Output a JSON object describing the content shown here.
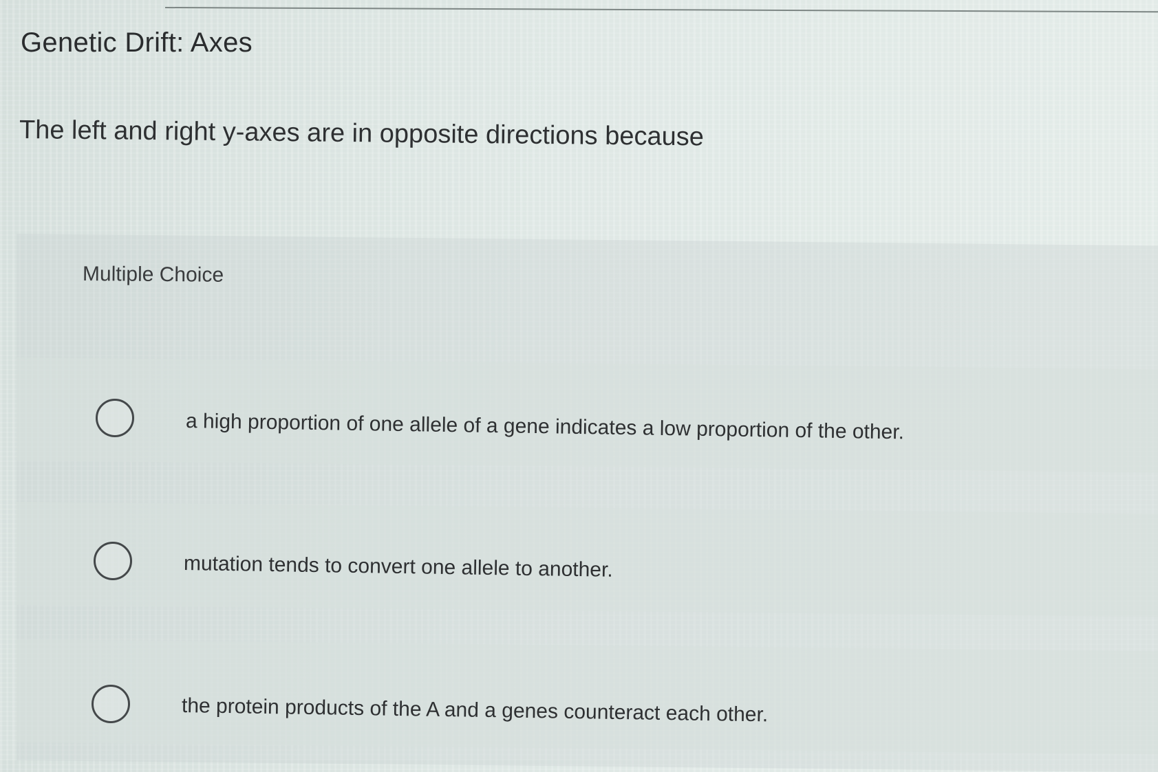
{
  "page": {
    "title": "Genetic Drift: Axes",
    "question": "The left and right y-axes are in opposite directions because",
    "section_label": "Multiple Choice"
  },
  "options": [
    {
      "text": "a high proportion of one allele of a gene indicates a low proportion of the other.",
      "selected": false
    },
    {
      "text": "mutation tends to convert one allele to another.",
      "selected": false
    },
    {
      "text": "the protein products of the A and a genes counteract each other.",
      "selected": false
    }
  ]
}
